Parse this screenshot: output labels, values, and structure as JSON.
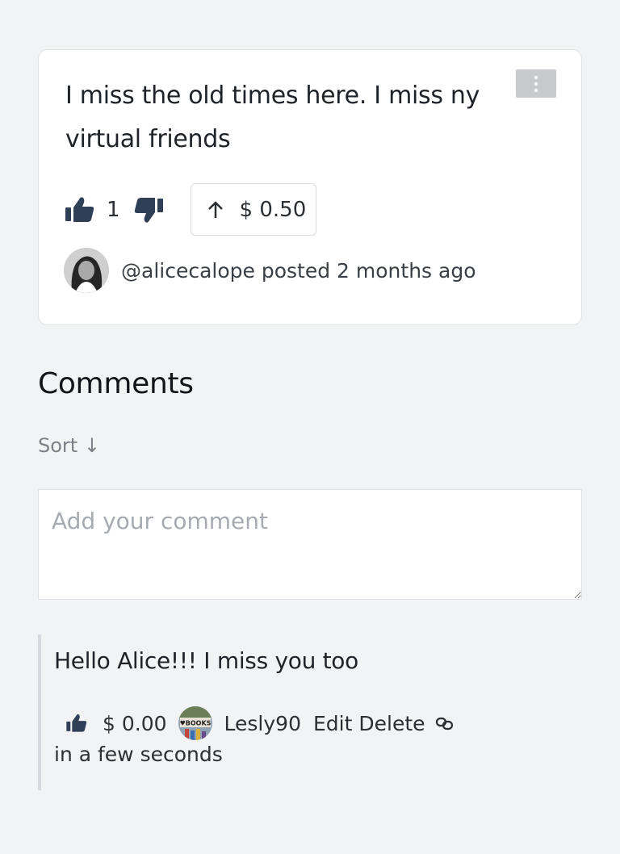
{
  "post": {
    "text": "I miss the old times here. I miss ny virtual friends",
    "like_count": "1",
    "tip_amount": "$ 0.50",
    "author_handle": "@alicecalope",
    "posted_text": " posted 2 months ago",
    "icons": {
      "menu": "kebab-menu-icon",
      "like": "thumbs-up-icon",
      "dislike": "thumbs-down-icon",
      "tip": "arrow-up-icon"
    }
  },
  "comments_section": {
    "title": "Comments",
    "sort_label": "Sort ↓",
    "input_placeholder": "Add your comment"
  },
  "comments": [
    {
      "text": "Hello Alice!!! I miss you too",
      "tip_amount": "$ 0.00",
      "avatar_text": "♥BOOKS",
      "username": "Lesly90",
      "edit_label": "Edit",
      "delete_label": "Delete",
      "time": "in a few seconds",
      "icons": {
        "like": "thumbs-up-icon",
        "permalink": "link-icon"
      }
    }
  ],
  "colors": {
    "background": "#f2f3f5",
    "card": "#ffffff",
    "border": "#dfe2e6",
    "menu_button": "#c7c9cc",
    "muted_text": "#7b8087",
    "placeholder": "#a7abb1"
  }
}
